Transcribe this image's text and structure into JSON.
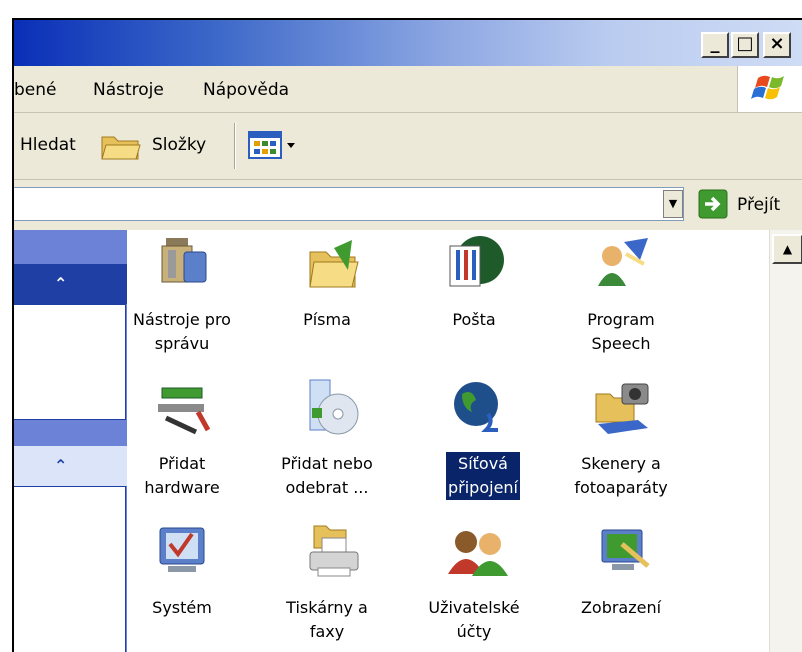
{
  "titlebar": {
    "minimize_glyph": "_",
    "maximize_glyph": "□",
    "close_glyph": "×"
  },
  "menu": {
    "items": [
      "bené",
      "Nástroje",
      "Nápověda"
    ]
  },
  "toolbar": {
    "search_label": "Hledat",
    "folders_label": "Složky"
  },
  "address": {
    "go_label": "Přejít"
  },
  "taskpane": {
    "collapse_glyph": "⌃"
  },
  "items": [
    {
      "label": "Nástroje pro\nsprávu",
      "icon": "admin-tools-icon"
    },
    {
      "label": "Písma",
      "icon": "fonts-folder-icon"
    },
    {
      "label": "Pošta",
      "icon": "mail-icon"
    },
    {
      "label": "Program\nSpeech",
      "icon": "speech-icon"
    },
    {
      "label": "Přidat\nhardware",
      "icon": "add-hardware-icon"
    },
    {
      "label": "Přidat nebo\nodebrat ...",
      "icon": "add-remove-programs-icon"
    },
    {
      "label": "Síťová\npřipojení",
      "icon": "network-connections-icon"
    },
    {
      "label": "Skenery a\nfotoaparáty",
      "icon": "scanners-cameras-icon"
    },
    {
      "label": "Systém",
      "icon": "system-icon"
    },
    {
      "label": "Tiskárny a\nfaxy",
      "icon": "printers-faxes-icon"
    },
    {
      "label": "Uživatelské\núčty",
      "icon": "user-accounts-icon"
    },
    {
      "label": "Zobrazení",
      "icon": "display-icon"
    }
  ],
  "selected_item": "Síťová\npřipojení"
}
